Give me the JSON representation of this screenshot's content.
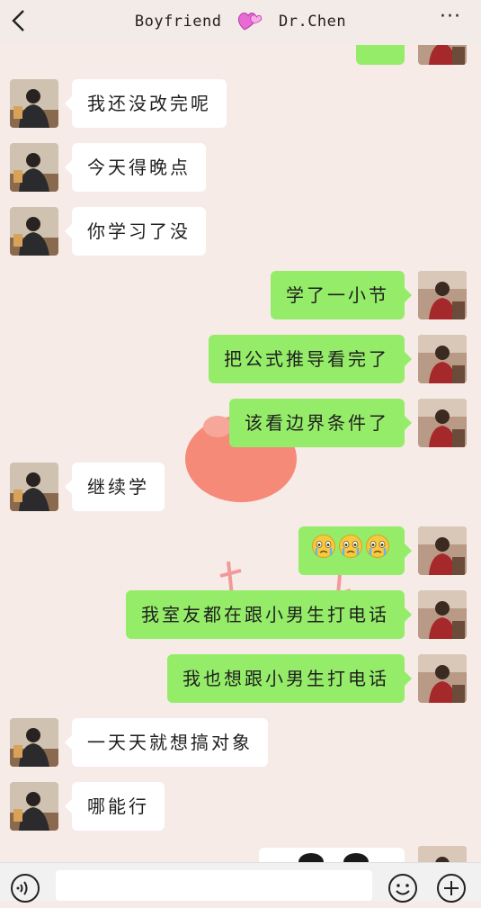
{
  "header": {
    "title_left": "Boyfriend",
    "title_right": "Dr.Chen",
    "icons": [
      "back-arrow-icon",
      "heart-icon",
      "more-dots-icon"
    ],
    "more_label": "···"
  },
  "colors": {
    "background": "#f7ebe8",
    "incoming_bubble": "#ffffff",
    "outgoing_bubble": "#95ec69",
    "header": "#f2ebe8"
  },
  "messages": [
    {
      "side": "in",
      "text": "我还没改完呢"
    },
    {
      "side": "in",
      "text": "今天得晚点"
    },
    {
      "side": "in",
      "text": "你学习了没"
    },
    {
      "side": "out",
      "text": "学了一小节"
    },
    {
      "side": "out",
      "text": "把公式推导看完了"
    },
    {
      "side": "out",
      "text": "该看边界条件了"
    },
    {
      "side": "in",
      "text": "继续学"
    },
    {
      "side": "out",
      "text": "",
      "emoji": [
        "crying-face-emoji",
        "crying-face-emoji",
        "crying-face-emoji"
      ]
    },
    {
      "side": "out",
      "text": "我室友都在跟小男生打电话"
    },
    {
      "side": "out",
      "text": "我也想跟小男生打电话"
    },
    {
      "side": "in",
      "text": "一天天就想搞对象"
    },
    {
      "side": "in",
      "text": "哪能行"
    }
  ],
  "input_bar": {
    "icons": [
      "voice-icon",
      "emoji-icon",
      "plus-icon"
    ]
  }
}
